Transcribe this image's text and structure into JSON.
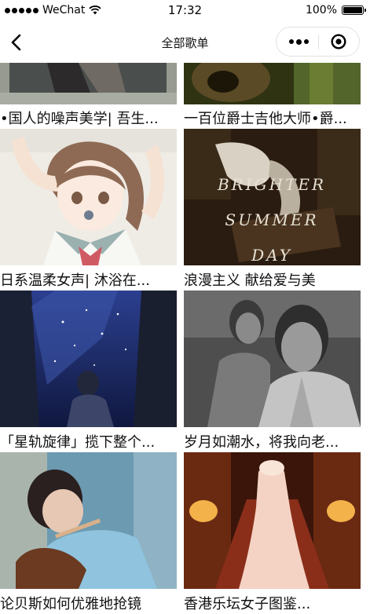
{
  "status_bar": {
    "carrier": "WeChat",
    "time": "17:32",
    "battery": "100%",
    "battery_level": 1.0
  },
  "nav": {
    "title": "全部歌单"
  },
  "playlists": [
    {
      "title": "•国人的噪声美学| 吾生..."
    },
    {
      "title": "一百位爵士吉他大师•爵..."
    },
    {
      "title": "日系温柔女声| 沐浴在..."
    },
    {
      "title": "浪漫主义 献给爱与美"
    },
    {
      "title": "「星轨旋律」揽下整个..."
    },
    {
      "title": "岁月如潮水，将我向老..."
    },
    {
      "title": "论贝斯如何优雅地抢镜"
    },
    {
      "title": "香港乐坛女子图鉴..."
    }
  ],
  "cover_text": {
    "brighter": "BRIGHTER",
    "summer": "SUMMER",
    "day": "DAY"
  }
}
